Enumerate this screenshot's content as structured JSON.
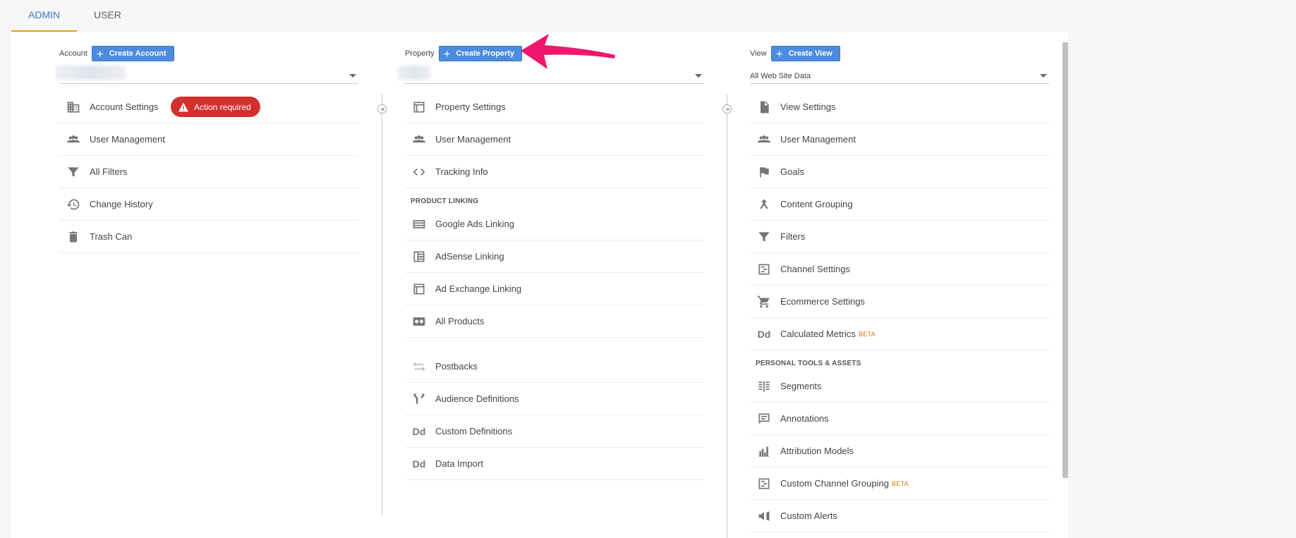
{
  "tabs": [
    {
      "label": "ADMIN",
      "active": true
    },
    {
      "label": "USER",
      "active": false
    }
  ],
  "account": {
    "label": "Account",
    "create_label": "Create Account",
    "selected": "",
    "items": [
      {
        "label": "Account Settings",
        "icon": "building-icon"
      },
      {
        "label": "User Management",
        "icon": "users-icon"
      },
      {
        "label": "All Filters",
        "icon": "filter-icon"
      },
      {
        "label": "Change History",
        "icon": "history-icon"
      },
      {
        "label": "Trash Can",
        "icon": "trash-icon"
      }
    ],
    "badge": "Action required"
  },
  "property": {
    "label": "Property",
    "create_label": "Create Property",
    "selected": "",
    "items": [
      {
        "label": "Property Settings",
        "icon": "layout-icon"
      },
      {
        "label": "User Management",
        "icon": "users-icon"
      },
      {
        "label": "Tracking Info",
        "icon": "code-icon"
      }
    ],
    "section_title": "PRODUCT LINKING",
    "linking_items": [
      {
        "label": "Google Ads Linking",
        "icon": "ads-icon"
      },
      {
        "label": "AdSense Linking",
        "icon": "adsense-icon"
      },
      {
        "label": "Ad Exchange Linking",
        "icon": "layout-icon"
      },
      {
        "label": "All Products",
        "icon": "products-icon"
      }
    ],
    "other_items": [
      {
        "label": "Postbacks",
        "icon": "postbacks-icon"
      },
      {
        "label": "Audience Definitions",
        "icon": "audience-icon"
      },
      {
        "label": "Custom Definitions",
        "icon": "dd-icon"
      },
      {
        "label": "Data Import",
        "icon": "dd-icon"
      }
    ]
  },
  "view": {
    "label": "View",
    "create_label": "Create View",
    "selected": "All Web Site Data",
    "items": [
      {
        "label": "View Settings",
        "icon": "document-icon"
      },
      {
        "label": "User Management",
        "icon": "users-icon"
      },
      {
        "label": "Goals",
        "icon": "flag-icon"
      },
      {
        "label": "Content Grouping",
        "icon": "grouping-icon"
      },
      {
        "label": "Filters",
        "icon": "filter-icon"
      },
      {
        "label": "Channel Settings",
        "icon": "channel-icon"
      },
      {
        "label": "Ecommerce Settings",
        "icon": "cart-icon"
      },
      {
        "label": "Calculated Metrics",
        "icon": "dd-icon",
        "beta": "BETA"
      }
    ],
    "section_title": "PERSONAL TOOLS & ASSETS",
    "tools_items": [
      {
        "label": "Segments",
        "icon": "segments-icon"
      },
      {
        "label": "Annotations",
        "icon": "comment-icon"
      },
      {
        "label": "Attribution Models",
        "icon": "bars-icon"
      },
      {
        "label": "Custom Channel Grouping",
        "icon": "channel-icon",
        "beta": "BETA"
      },
      {
        "label": "Custom Alerts",
        "icon": "megaphone-icon"
      }
    ]
  },
  "dd_glyph": "Dd"
}
